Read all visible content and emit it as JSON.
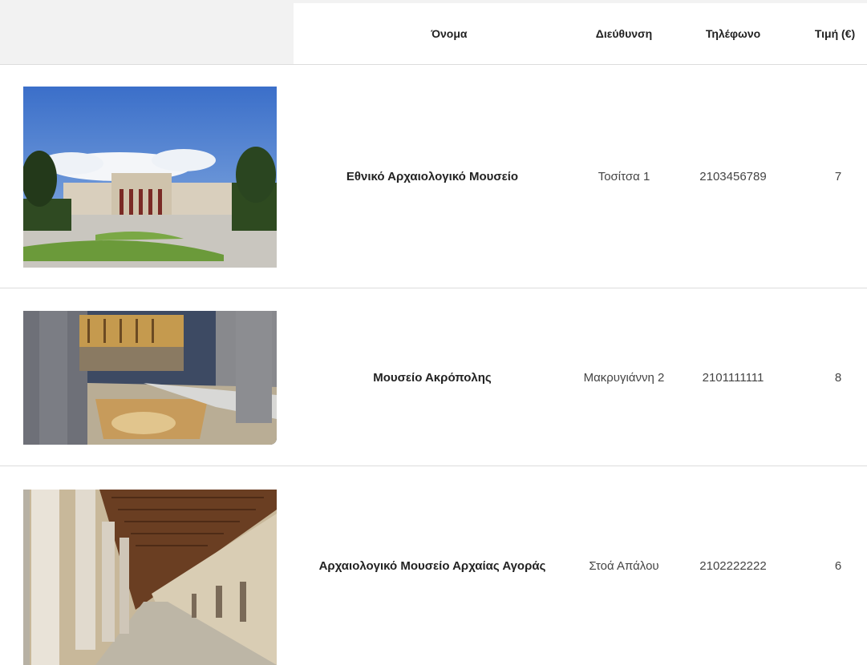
{
  "table": {
    "headers": {
      "name": "Όνομα",
      "address": "Διεύθυνση",
      "phone": "Τηλέφωνο",
      "price": "Τιμή (€)"
    },
    "rows": [
      {
        "image_icon": "museum-photo",
        "name": "Εθνικό Αρχαιολογικό Μουσείο",
        "address": "Τοσίτσα 1",
        "phone": "2103456789",
        "price": "7"
      },
      {
        "image_icon": "museum-photo",
        "name": "Μουσείο Ακρόπολης",
        "address": "Μακρυγιάννη 2",
        "phone": "2101111111",
        "price": "8"
      },
      {
        "image_icon": "museum-photo",
        "name": "Αρχαιολογικό Μουσείο Αρχαίας Αγοράς",
        "address": "Στοά Απάλου",
        "phone": "2102222222",
        "price": "6"
      }
    ]
  }
}
